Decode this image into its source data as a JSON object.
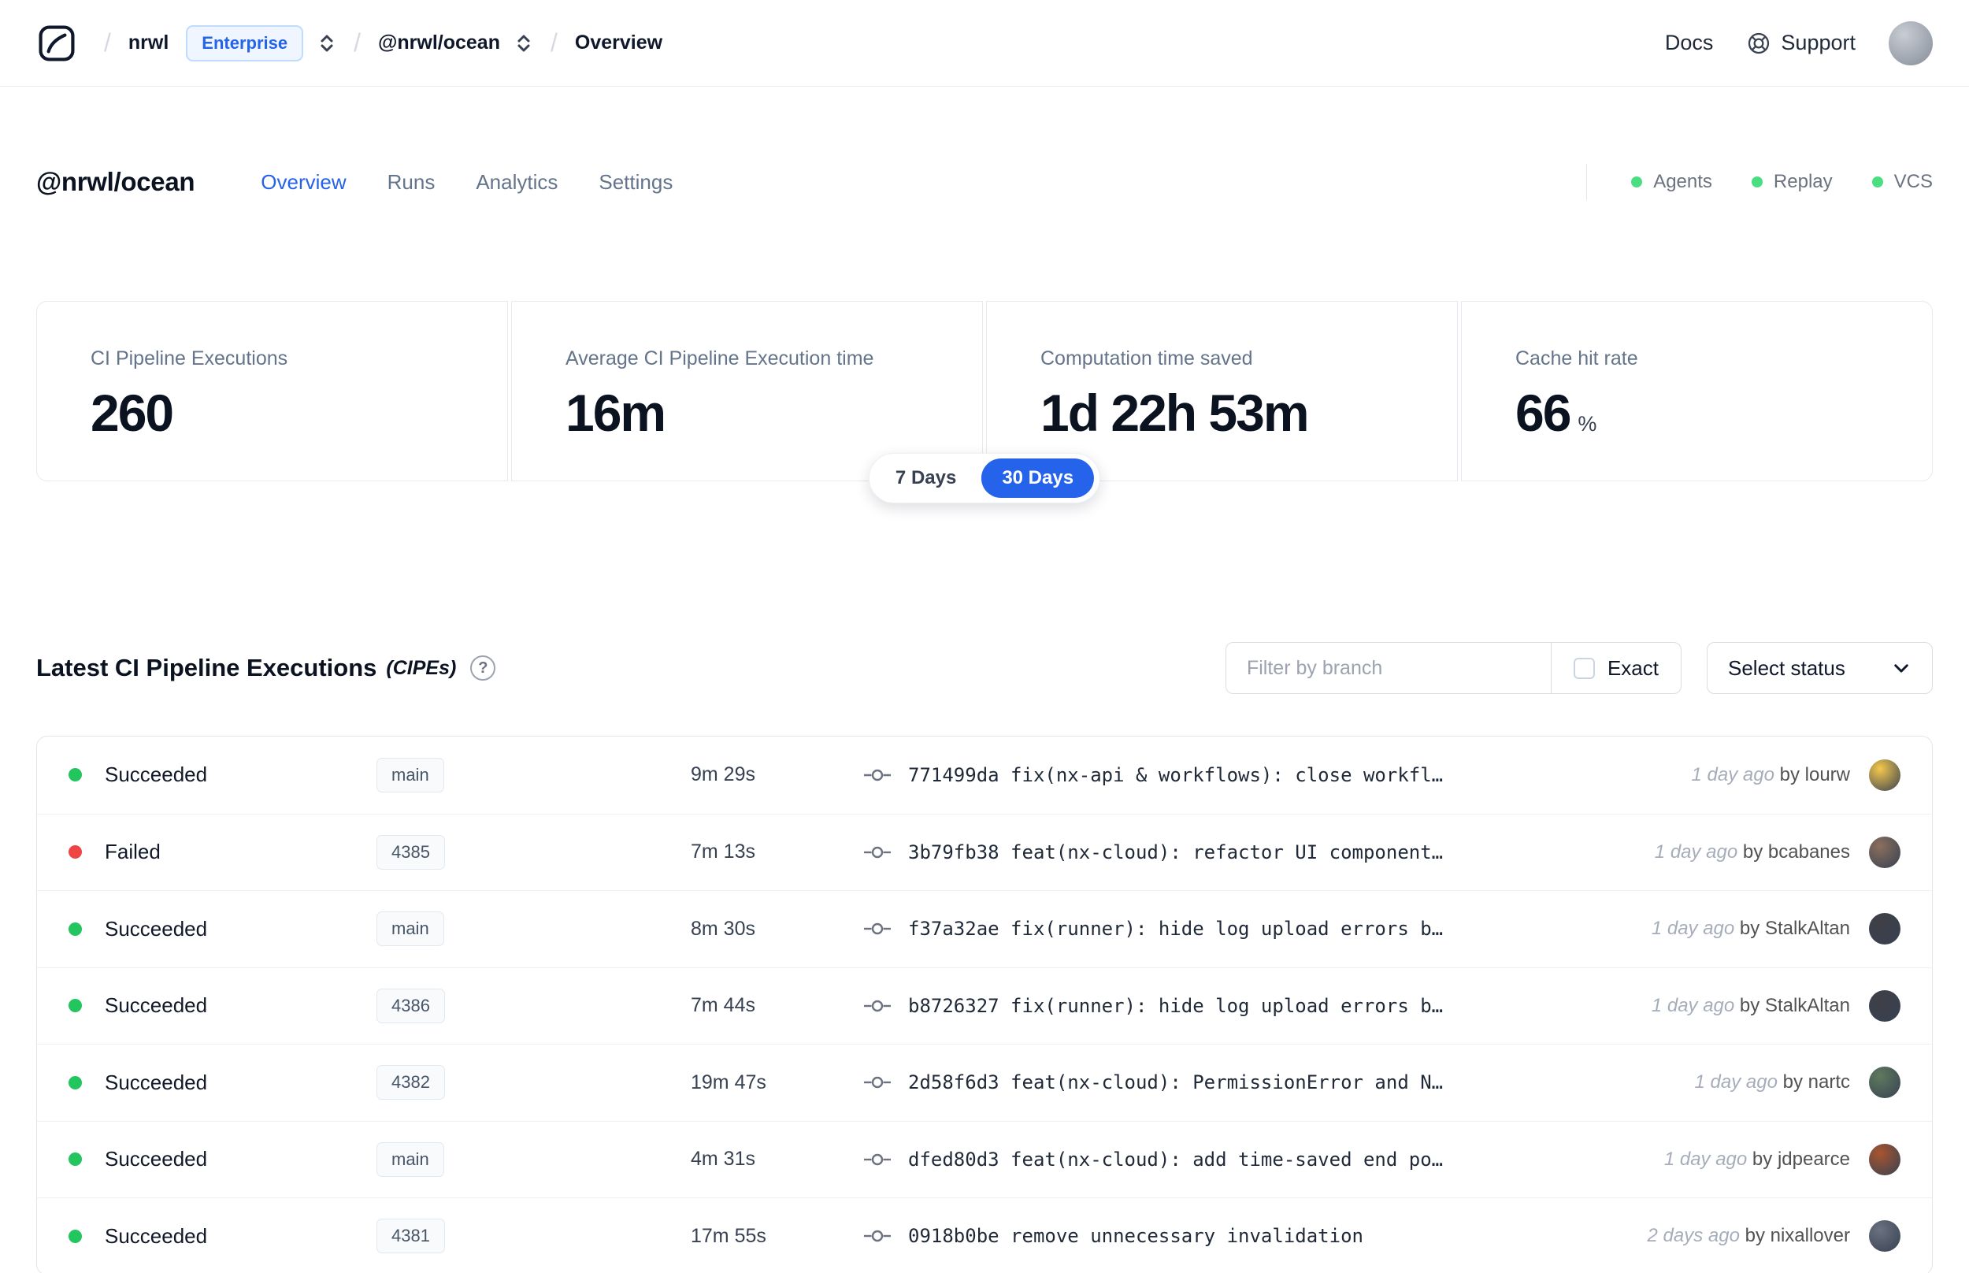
{
  "topbar": {
    "logo": "nx-cloud-logo",
    "breadcrumb": {
      "org": "nrwl",
      "org_badge": "Enterprise",
      "workspace": "@nrwl/ocean",
      "page": "Overview"
    },
    "docs_label": "Docs",
    "support_label": "Support"
  },
  "header": {
    "title": "@nrwl/ocean",
    "tabs": [
      {
        "label": "Overview",
        "active": true
      },
      {
        "label": "Runs",
        "active": false
      },
      {
        "label": "Analytics",
        "active": false
      },
      {
        "label": "Settings",
        "active": false
      }
    ],
    "indicators": [
      {
        "label": "Agents",
        "color": "#4ade80"
      },
      {
        "label": "Replay",
        "color": "#4ade80"
      },
      {
        "label": "VCS",
        "color": "#4ade80"
      }
    ]
  },
  "stats": {
    "cards": [
      {
        "label": "CI Pipeline Executions",
        "value": "260",
        "suffix": ""
      },
      {
        "label": "Average CI Pipeline Execution time",
        "value": "16m",
        "suffix": ""
      },
      {
        "label": "Computation time saved",
        "value": "1d 22h 53m",
        "suffix": ""
      },
      {
        "label": "Cache hit rate",
        "value": "66",
        "suffix": "%"
      }
    ],
    "range": {
      "options": [
        {
          "label": "7 Days",
          "active": false
        },
        {
          "label": "30 Days",
          "active": true
        }
      ]
    }
  },
  "cipe": {
    "title": "Latest CI Pipeline Executions",
    "title_suffix": "(CIPEs)",
    "filter_placeholder": "Filter by branch",
    "exact_label": "Exact",
    "status_button": "Select status"
  },
  "table": {
    "rows": [
      {
        "status": "Succeeded",
        "status_color": "#22c55e",
        "branch": "main",
        "duration": "9m 29s",
        "commit": "771499da fix(nx-api & workflows): close workfl…",
        "time": "1 day ago",
        "author": "by lourw",
        "avatar_color": "#f5c84c"
      },
      {
        "status": "Failed",
        "status_color": "#ef4444",
        "branch": "4385",
        "duration": "7m 13s",
        "commit": "3b79fb38 feat(nx-cloud): refactor UI component…",
        "time": "1 day ago",
        "author": "by bcabanes",
        "avatar_color": "#8b6f5e"
      },
      {
        "status": "Succeeded",
        "status_color": "#22c55e",
        "branch": "main",
        "duration": "8m 30s",
        "commit": "f37a32ae fix(runner): hide log upload errors b…",
        "time": "1 day ago",
        "author": "by StalkAltan",
        "avatar_color": "#3f3f46"
      },
      {
        "status": "Succeeded",
        "status_color": "#22c55e",
        "branch": "4386",
        "duration": "7m 44s",
        "commit": "b8726327 fix(runner): hide log upload errors b…",
        "time": "1 day ago",
        "author": "by StalkAltan",
        "avatar_color": "#3f3f46"
      },
      {
        "status": "Succeeded",
        "status_color": "#22c55e",
        "branch": "4382",
        "duration": "19m 47s",
        "commit": "2d58f6d3 feat(nx-cloud): PermissionError and N…",
        "time": "1 day ago",
        "author": "by nartc",
        "avatar_color": "#5f7a5f"
      },
      {
        "status": "Succeeded",
        "status_color": "#22c55e",
        "branch": "main",
        "duration": "4m 31s",
        "commit": "dfed80d3 feat(nx-cloud): add time-saved end po…",
        "time": "1 day ago",
        "author": "by jdpearce",
        "avatar_color": "#a8552f"
      },
      {
        "status": "Succeeded",
        "status_color": "#22c55e",
        "branch": "4381",
        "duration": "17m 55s",
        "commit": "0918b0be remove unnecessary invalidation",
        "time": "2 days ago",
        "author": "by nixallover",
        "avatar_color": "#6b7280"
      }
    ]
  },
  "colors": {
    "accent": "#2563eb",
    "success": "#22c55e",
    "danger": "#ef4444"
  }
}
